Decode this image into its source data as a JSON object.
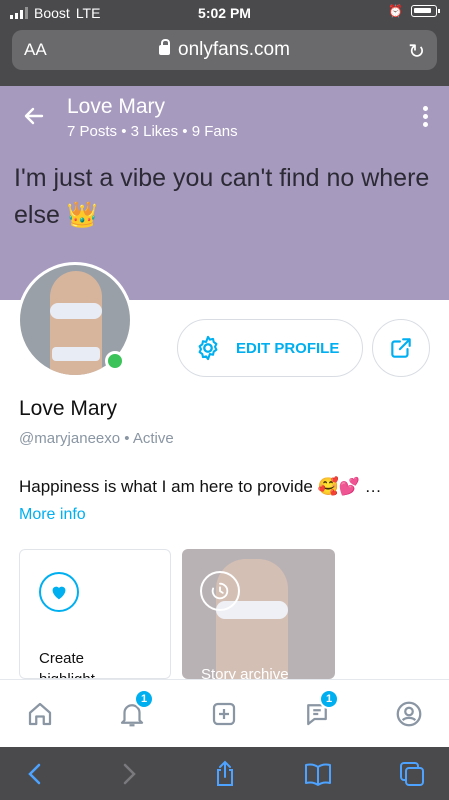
{
  "status_bar": {
    "carrier": "Boost",
    "network": "LTE",
    "time": "5:02 PM"
  },
  "browser": {
    "text_size_label": "AA",
    "url": "onlyfans.com"
  },
  "cover": {
    "name": "Love Mary",
    "stats": "7 Posts • 3 Likes • 9 Fans",
    "quote": "I'm just a vibe you can't find no where else 👑"
  },
  "profile": {
    "edit_label": "EDIT PROFILE",
    "display_name": "Love Mary",
    "handle": "@maryjaneexo",
    "status": "Active",
    "bio": "Happiness is what I am here to provide 🥰💕 …",
    "more_info": "More info"
  },
  "highlights": {
    "create_label": "Create highlight",
    "archive_label": "Story archive"
  },
  "nav": {
    "notifications_badge": "1",
    "messages_badge": "1"
  },
  "colors": {
    "accent": "#00aff0",
    "online": "#3cc35a",
    "cover": "#a79abf",
    "chrome": "#4a4a4c"
  }
}
